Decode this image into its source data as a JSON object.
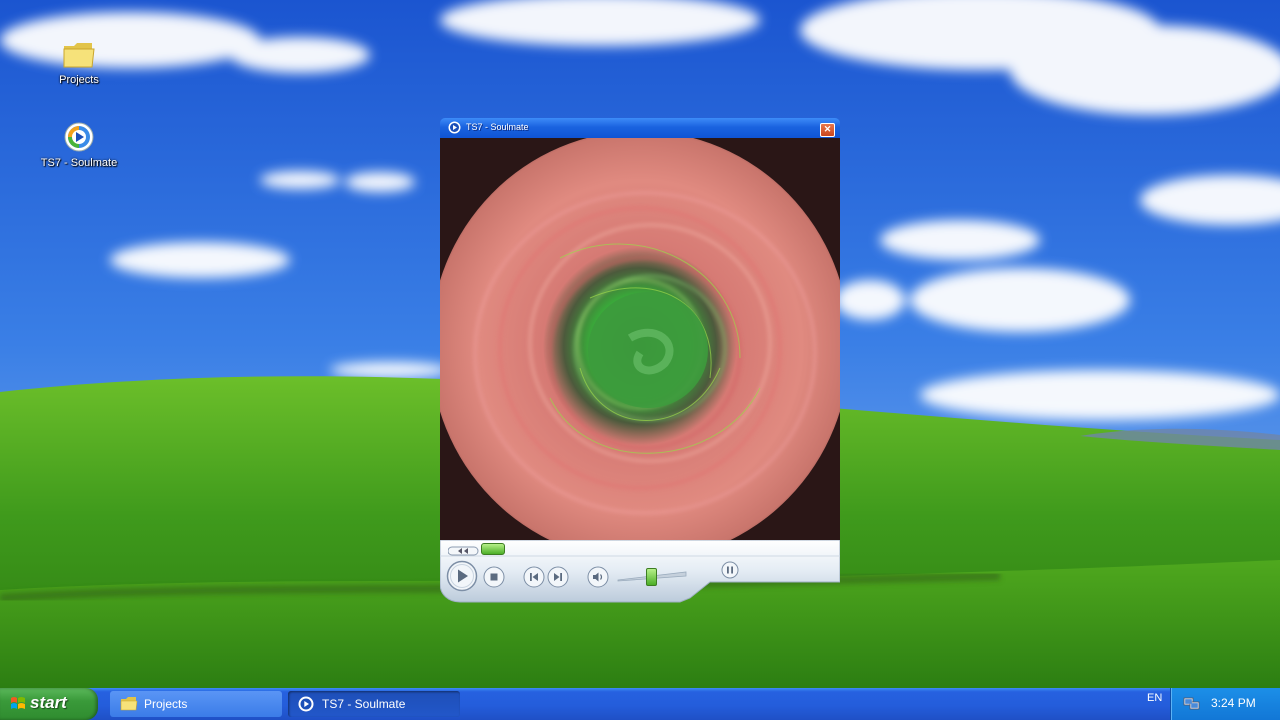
{
  "desktop": {
    "icons": [
      {
        "label": "Projects",
        "icon": "folder-icon"
      },
      {
        "label": "TS7 - Soulmate",
        "icon": "media-file-icon"
      }
    ]
  },
  "player": {
    "title": "TS7 - Soulmate",
    "app_icon": "windows-media-player-icon",
    "close_glyph": "✕",
    "position_fraction": 0.03,
    "volume_fraction": 0.5,
    "controls": [
      "play-icon",
      "stop-icon",
      "previous-icon",
      "next-icon",
      "mute-icon",
      "switch-to-full-mode-icon"
    ]
  },
  "taskbar": {
    "start_label": "start",
    "buttons": [
      {
        "label": "Projects",
        "icon": "folder-icon"
      },
      {
        "label": "TS7 - Soulmate",
        "icon": "windows-media-player-icon"
      }
    ],
    "language": "EN",
    "clock": "3:24 PM"
  },
  "colors": {
    "sky": "#2f6fe0",
    "grass": "#3f9a1c",
    "title_bar": "#1a63e0",
    "taskbar": "#245ddb",
    "start_green": "#3a9a3a",
    "tray": "#1277d6"
  }
}
